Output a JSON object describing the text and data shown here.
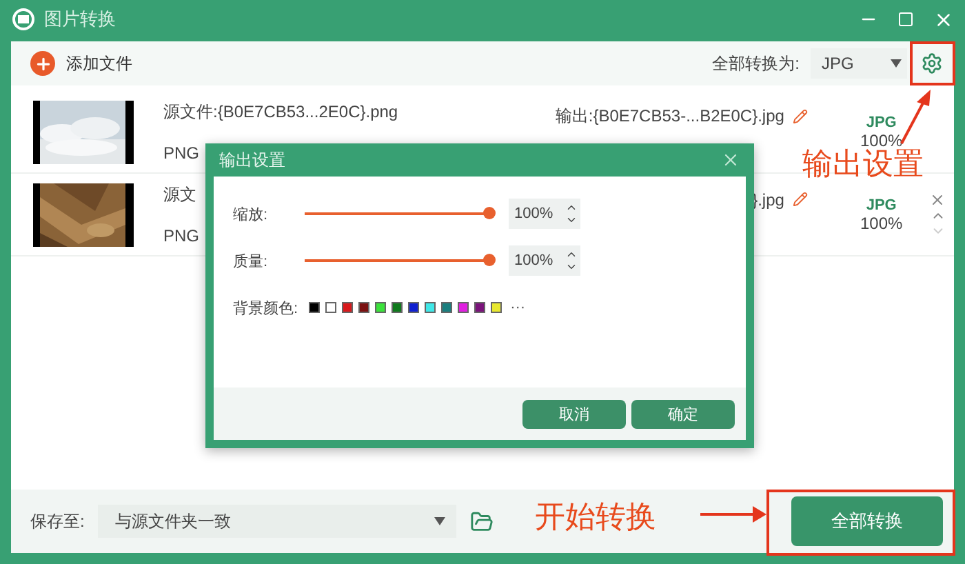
{
  "window": {
    "title": "图片转换"
  },
  "toolbar": {
    "add_file": "添加文件",
    "convert_all_label": "全部转换为:",
    "format_value": "JPG"
  },
  "files": [
    {
      "source": "源文件:{B0E7CB53...2E0C}.png",
      "format": "PNG",
      "output": "输出:{B0E7CB53-...B2E0C}.jpg",
      "target_format": "JPG",
      "target_quality": "100%",
      "scroll_controls": false
    },
    {
      "source": "源文",
      "format": "PNG",
      "output": "}.jpg",
      "target_format": "JPG",
      "target_quality": "100%",
      "scroll_controls": true
    }
  ],
  "dialog": {
    "title": "输出设置",
    "sliders": [
      {
        "label": "缩放:",
        "level": 1,
        "value": "100%"
      },
      {
        "label": "质量:",
        "level": 1,
        "value": "100%"
      }
    ],
    "colors_label": "背景颜色:",
    "colors": [
      {
        "color": "#000000"
      },
      {
        "color": "#ffffff"
      },
      {
        "color": "#d9191c"
      },
      {
        "color": "#7a1010"
      },
      {
        "color": "#3be23b"
      },
      {
        "color": "#0f7a1c"
      },
      {
        "color": "#1020d0"
      },
      {
        "color": "#40e8e8"
      },
      {
        "color": "#1a7f7f"
      },
      {
        "color": "#e020e0"
      },
      {
        "color": "#7a137a"
      },
      {
        "color": "#e8e830"
      }
    ],
    "more_colors": "···",
    "buttons": [
      "取消",
      "确定"
    ]
  },
  "bottom": {
    "save_label": "保存至:",
    "save_value": "与源文件夹一致",
    "start_button": "全部转换"
  },
  "settings_callout": "输出设置",
  "start_callout": "开始转换"
}
